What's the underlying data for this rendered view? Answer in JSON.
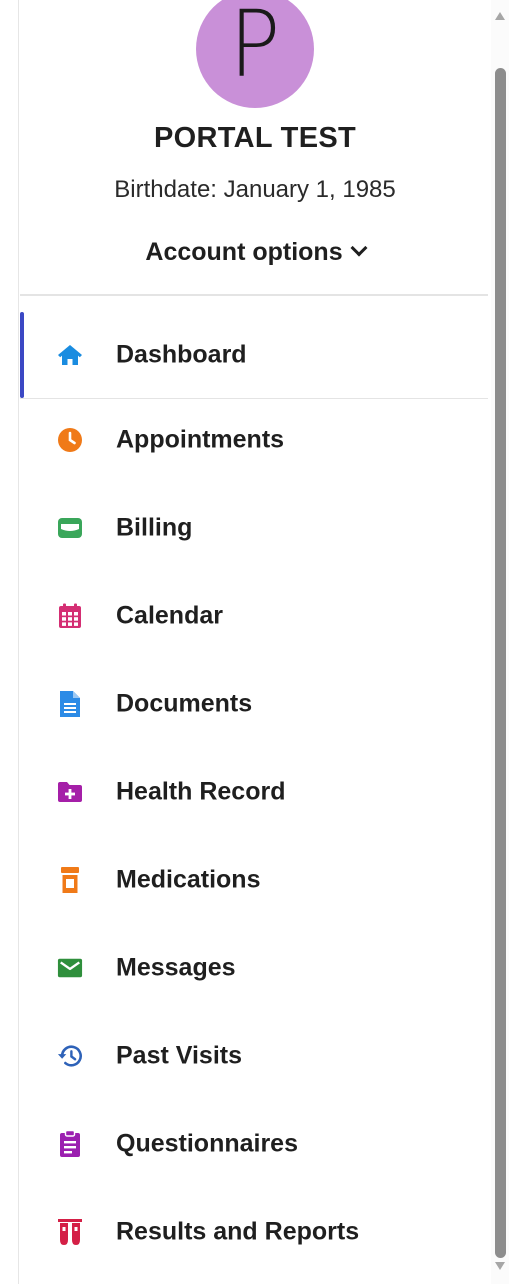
{
  "profile": {
    "avatar_initial": "P",
    "avatar_color": "#c990d8",
    "name": "PORTAL TEST",
    "birthdate": "Birthdate: January 1, 1985",
    "account_options_label": "Account options"
  },
  "nav": {
    "active_color": "#3b48c4",
    "items": [
      {
        "label": "Dashboard",
        "icon": "home-icon",
        "color": "#1a8ce0",
        "active": true
      },
      {
        "label": "Appointments",
        "icon": "clock-icon",
        "color": "#f07a18"
      },
      {
        "label": "Billing",
        "icon": "wallet-icon",
        "color": "#3aa65a"
      },
      {
        "label": "Calendar",
        "icon": "calendar-icon",
        "color": "#d42e73"
      },
      {
        "label": "Documents",
        "icon": "document-icon",
        "color": "#2c8be6"
      },
      {
        "label": "Health Record",
        "icon": "folder-plus-icon",
        "color": "#a51fa8"
      },
      {
        "label": "Medications",
        "icon": "pill-bottle-icon",
        "color": "#f07a18"
      },
      {
        "label": "Messages",
        "icon": "envelope-icon",
        "color": "#2f8f3c"
      },
      {
        "label": "Past Visits",
        "icon": "history-icon",
        "color": "#2e62b8"
      },
      {
        "label": "Questionnaires",
        "icon": "clipboard-icon",
        "color": "#9b1fb0"
      },
      {
        "label": "Results and Reports",
        "icon": "test-tubes-icon",
        "color": "#d41f46"
      }
    ]
  }
}
